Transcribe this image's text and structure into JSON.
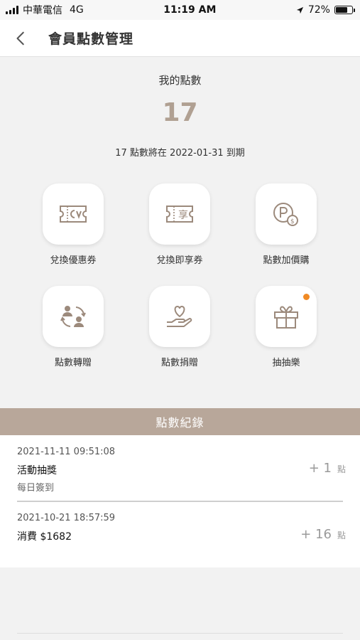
{
  "status_bar": {
    "carrier": "中華電信",
    "network": "4G",
    "time": "11:19 AM",
    "battery": "72%",
    "battery_level": 0.72
  },
  "nav": {
    "title": "會員點數管理",
    "back_icon": "chevron-left-icon"
  },
  "points": {
    "label": "我的點數",
    "value": "17",
    "expiry": "17 點數將在 2022-01-31 到期"
  },
  "actions": [
    {
      "label": "兌換優惠券",
      "icon": "coupon-icon"
    },
    {
      "label": "兌換即享券",
      "icon": "instant-coupon-icon"
    },
    {
      "label": "點數加價購",
      "icon": "points-coin-icon"
    },
    {
      "label": "點數轉贈",
      "icon": "transfer-users-icon"
    },
    {
      "label": "點數捐贈",
      "icon": "donate-heart-icon"
    },
    {
      "label": "抽抽樂",
      "icon": "gift-box-icon",
      "badge": true
    }
  ],
  "records": {
    "header": "點數紀錄",
    "items": [
      {
        "time": "2021-11-11 09:51:08",
        "title": "活動抽獎",
        "subtitle": "每日簽到",
        "amount": "+ 1",
        "unit": "點"
      },
      {
        "time": "2021-10-21 18:57:59",
        "title": "消費 $1682",
        "subtitle": "",
        "amount": "+ 16",
        "unit": "點"
      }
    ]
  },
  "colors": {
    "accent": "#b8a79a",
    "points_value": "#b0a092",
    "badge": "#f08a24",
    "icon_stroke": "#9c8a7c"
  }
}
